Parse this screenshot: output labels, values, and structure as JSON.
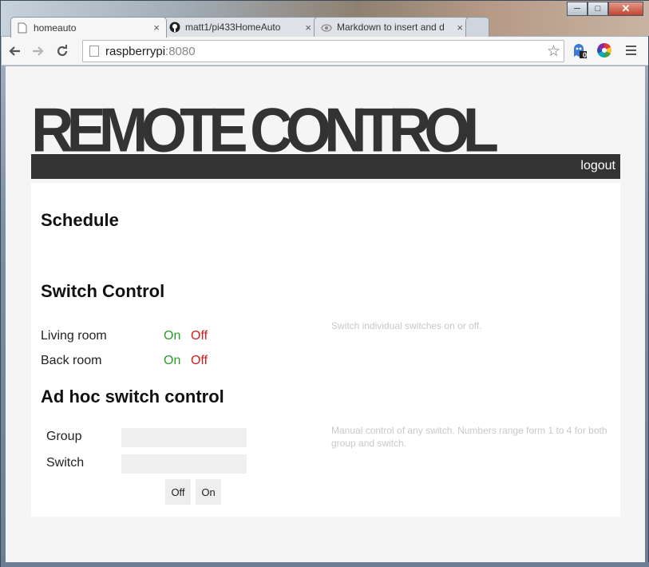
{
  "browser": {
    "tabs": [
      {
        "title": "homeauto",
        "icon": "page-icon",
        "active": true
      },
      {
        "title": "matt1/pi433HomeAuto",
        "icon": "github-icon",
        "active": false
      },
      {
        "title": "Markdown to insert and d",
        "icon": "cloud-icon",
        "active": false
      }
    ],
    "close_glyph": "×",
    "window_buttons": {
      "minimize": "─",
      "maximize": "□",
      "close": "✕"
    },
    "url_host": "raspberrypi",
    "url_port": ":8080",
    "extension_badge": "0"
  },
  "page": {
    "brand": "REMOTE CONTROL",
    "logout": "logout",
    "sections": {
      "schedule": {
        "title": "Schedule"
      },
      "switch_control": {
        "title": "Switch Control",
        "help": "Switch individual switches on or off.",
        "switches": [
          {
            "name": "Living room",
            "on": "On",
            "off": "Off"
          },
          {
            "name": "Back room",
            "on": "On",
            "off": "Off"
          }
        ]
      },
      "adhoc": {
        "title": "Ad hoc switch control",
        "help": "Manual control of any switch. Numbers range form 1 to 4 for both group and switch.",
        "group_label": "Group",
        "switch_label": "Switch",
        "group_value": "",
        "switch_value": "",
        "off_button": "Off",
        "on_button": "On"
      }
    }
  },
  "colors": {
    "on": "#2a9a2a",
    "off": "#d01c1c",
    "header": "#333333"
  }
}
